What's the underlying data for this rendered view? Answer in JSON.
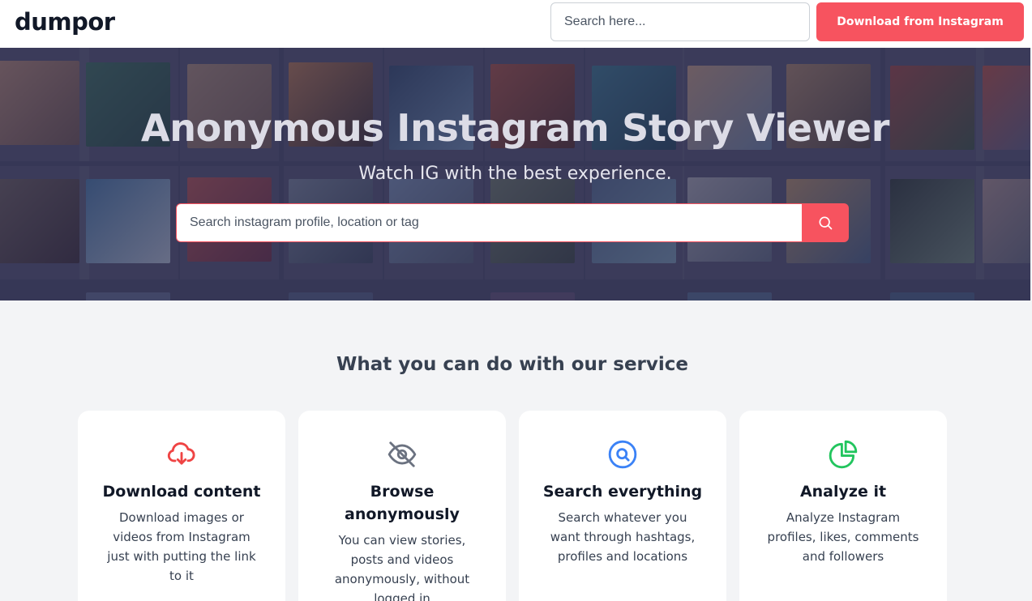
{
  "header": {
    "logo": "dumpor",
    "search_placeholder": "Search here...",
    "download_label": "Download from Instagram"
  },
  "hero": {
    "title": "Anonymous Instagram Story Viewer",
    "subtitle": "Watch IG with the best experience.",
    "search_placeholder": "Search instagram profile, location or tag",
    "search_button_icon": "search-icon"
  },
  "services": {
    "title": "What you can do with our service",
    "cards": [
      {
        "icon": "cloud-download-icon",
        "icon_color": "#ef4444",
        "title": "Download content",
        "description": "Download images or videos from Instagram just with putting the link to it"
      },
      {
        "icon": "eye-off-icon",
        "icon_color": "#6b7280",
        "title": "Browse anonymously",
        "description": "You can view stories, posts and videos anonymously, without logged in"
      },
      {
        "icon": "search-circle-icon",
        "icon_color": "#3b82f6",
        "title": "Search everything",
        "description": "Search whatever you want through hashtags, profiles and locations"
      },
      {
        "icon": "pie-chart-icon",
        "icon_color": "#22c55e",
        "title": "Analyze it",
        "description": "Analyze Instagram profiles, likes, comments and followers"
      }
    ]
  },
  "colors": {
    "accent": "#f7535f",
    "page_background": "#f3f4f6",
    "hero_overlay": "#2c2c4e"
  }
}
